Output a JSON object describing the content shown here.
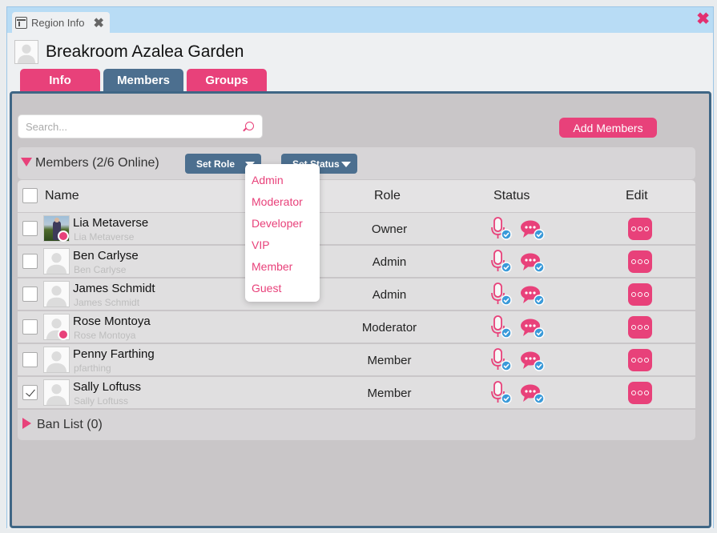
{
  "window": {
    "tab_title": "Region Info",
    "close_label": "✖",
    "tab_close_label": "✖"
  },
  "page": {
    "title": "Breakroom Azalea Garden"
  },
  "tabs": [
    {
      "label": "Info",
      "active": false
    },
    {
      "label": "Members",
      "active": true
    },
    {
      "label": "Groups",
      "active": false
    }
  ],
  "search": {
    "placeholder": "Search...",
    "value": ""
  },
  "add_members_label": "Add Members",
  "members_section": {
    "title": "Members (2/6 Online)",
    "set_role_label": "Set Role",
    "set_status_label": "Set Status"
  },
  "table": {
    "headers": {
      "name": "Name",
      "role": "Role",
      "status": "Status",
      "edit": "Edit"
    },
    "rows": [
      {
        "name": "Lia Metaverse",
        "username": "Lia Metaverse",
        "role": "Owner",
        "online": true,
        "photo": true,
        "checked": false
      },
      {
        "name": "Ben Carlyse",
        "username": "Ben Carlyse",
        "role": "Admin",
        "online": false,
        "photo": false,
        "checked": false
      },
      {
        "name": "James Schmidt",
        "username": "James Schmidt",
        "role": "Admin",
        "online": false,
        "photo": false,
        "checked": false
      },
      {
        "name": "Rose Montoya",
        "username": "Rose Montoya",
        "role": "Moderator",
        "online": true,
        "photo": false,
        "checked": false
      },
      {
        "name": "Penny Farthing",
        "username": "pfarthing",
        "role": "Member",
        "online": false,
        "photo": false,
        "checked": false
      },
      {
        "name": "Sally Loftuss",
        "username": "Sally Loftuss",
        "role": "Member",
        "online": false,
        "photo": false,
        "checked": true
      }
    ]
  },
  "ban_list_label": "Ban List (0)",
  "role_menu": [
    "Admin",
    "Moderator",
    "Developer",
    "VIP",
    "Member",
    "Guest"
  ],
  "colors": {
    "accent_pink": "#e8417a",
    "nav_blue": "#4c6f8f",
    "verified_blue": "#3a9ad9"
  },
  "icons": {
    "status_mic": "microphone-verified-icon",
    "status_chat": "chat-bubble-verified-icon",
    "edit": "more-options-icon"
  }
}
